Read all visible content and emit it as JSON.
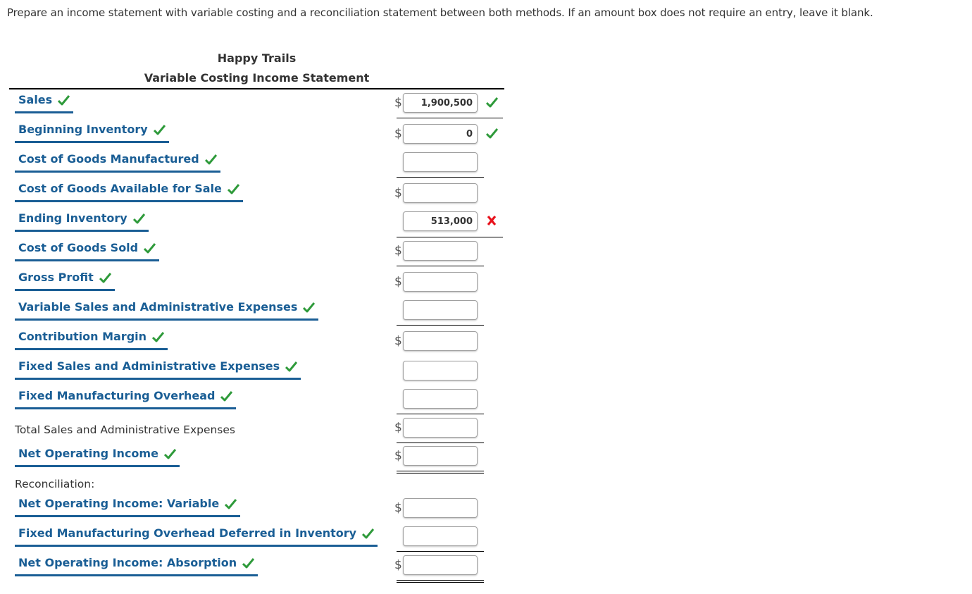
{
  "instructions": "Prepare an income statement with variable costing and a reconciliation statement between both methods. If an amount box does not require an entry, leave it blank.",
  "statement": {
    "company": "Happy Trails",
    "title": "Variable Costing Income Statement"
  },
  "rows": [
    {
      "label": "Sales",
      "value": "1,900,500",
      "dollar": true,
      "status": "correct",
      "label_status": "correct"
    },
    {
      "label": "Beginning Inventory",
      "value": "0",
      "dollar": true,
      "status": "correct",
      "label_status": "correct"
    },
    {
      "label": "Cost of Goods Manufactured",
      "value": "",
      "dollar": false,
      "status": "",
      "label_status": "correct"
    },
    {
      "label": "Cost of Goods Available for Sale",
      "value": "",
      "dollar": true,
      "status": "",
      "label_status": "correct"
    },
    {
      "label": "Ending Inventory",
      "value": "513,000",
      "dollar": false,
      "status": "incorrect",
      "label_status": "correct"
    },
    {
      "label": "Cost of Goods Sold",
      "value": "",
      "dollar": true,
      "status": "",
      "label_status": "correct"
    },
    {
      "label": "Gross Profit",
      "value": "",
      "dollar": true,
      "status": "",
      "label_status": "correct"
    },
    {
      "label": "Variable Sales and Administrative Expenses",
      "value": "",
      "dollar": false,
      "status": "",
      "label_status": "correct"
    },
    {
      "label": "Contribution Margin",
      "value": "",
      "dollar": true,
      "status": "",
      "label_status": "correct"
    },
    {
      "label": "Fixed Sales and Administrative Expenses",
      "value": "",
      "dollar": false,
      "status": "",
      "label_status": "correct"
    },
    {
      "label": "Fixed Manufacturing Overhead",
      "value": "",
      "dollar": false,
      "status": "",
      "label_status": "correct"
    },
    {
      "label": "Total Sales and Administrative Expenses",
      "value": "",
      "dollar": true,
      "status": "",
      "label_status": "none"
    },
    {
      "label": "Net Operating Income",
      "value": "",
      "dollar": true,
      "status": "",
      "label_status": "correct"
    }
  ],
  "reconciliation": {
    "heading": "Reconciliation:",
    "rows": [
      {
        "label": "Net Operating Income: Variable",
        "value": "",
        "dollar": true,
        "status": "",
        "label_status": "correct"
      },
      {
        "label": "Fixed Manufacturing Overhead Deferred in Inventory",
        "value": "",
        "dollar": false,
        "status": "",
        "label_status": "correct"
      },
      {
        "label": "Net Operating Income: Absorption",
        "value": "",
        "dollar": true,
        "status": "",
        "label_status": "correct"
      }
    ]
  },
  "symbols": {
    "currency": "$"
  },
  "colors": {
    "label_blue": "#1a5e95",
    "correct_green": "#2e9a3a",
    "incorrect_red": "#e8121c"
  }
}
